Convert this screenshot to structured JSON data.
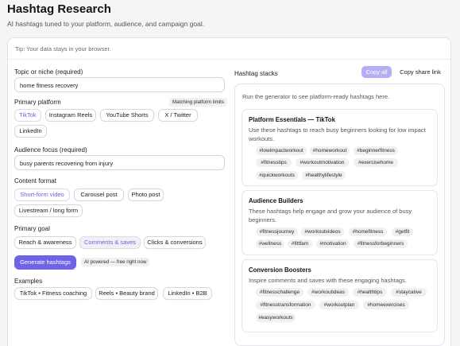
{
  "header": {
    "title": "Hashtag Research",
    "subtitle": "AI hashtags tuned to your platform, audience, and campaign goal."
  },
  "tip": "Tip: Your data stays in your browser.",
  "form": {
    "topic_label": "Topic or niche (required)",
    "topic_value": "home fitness recovery",
    "platform_label": "Primary platform",
    "platform_badge": "Matching platform limits",
    "platforms": [
      "TikTok",
      "Instagram Reels",
      "YouTube Shorts",
      "X / Twitter",
      "LinkedIn"
    ],
    "platform_selected": "TikTok",
    "audience_label": "Audience focus (required)",
    "audience_value": "busy parents recovering from injury",
    "format_label": "Content format",
    "formats": [
      "Short-form video",
      "Carousel post",
      "Photo post",
      "Livestream / long form"
    ],
    "format_selected": "Short-form video",
    "goal_label": "Primary goal",
    "goals": [
      "Reach & awareness",
      "Comments & saves",
      "Clicks & conversions"
    ],
    "goal_selected": "Comments & saves",
    "generate_label": "Generate hashtags",
    "ai_badge": "AI powered — free right now",
    "examples_label": "Examples",
    "examples": [
      "TikTok • Fitness coaching",
      "Reels • Beauty brand",
      "LinkedIn • B2B"
    ]
  },
  "stacks": {
    "heading": "Hashtag stacks",
    "copy_all_label": "Copy all",
    "share_label": "Copy share link",
    "hint": "Run the generator to see platform-ready hashtags here.",
    "items": [
      {
        "title": "Platform Essentials — TikTok",
        "description": "Use these hashtags to reach busy beginners looking for low impact workouts.",
        "tags": [
          "#lowimpactworkout",
          "#homeworkout",
          "#beginnerfitness",
          "#fitnesstips",
          "#workoutmotivation",
          "#exercisehome",
          "#quickworkouts",
          "#healthylifestyle"
        ]
      },
      {
        "title": "Audience Builders",
        "description": "These hashtags help engage and grow your audience of busy beginners.",
        "tags": [
          "#fitnessjourney",
          "#workoutvideos",
          "#homefitness",
          "#getfit",
          "#wellness",
          "#fittfam",
          "#motivation",
          "#fitnessforbeginners"
        ]
      },
      {
        "title": "Conversion Boosters",
        "description": "Inspire comments and saves with these engaging hashtags.",
        "tags": [
          "#fitnesschallenge",
          "#workoutideas",
          "#healthtips",
          "#staycative",
          "#fitnesstransformation",
          "#workoutplan",
          "#homeexercises",
          "#easyworkouts"
        ]
      }
    ]
  },
  "colors": {
    "accent": "#6f63ea",
    "accent_soft": "#b5aef2",
    "selected_text": "#6b5fe0",
    "background": "#f5f5f6"
  }
}
